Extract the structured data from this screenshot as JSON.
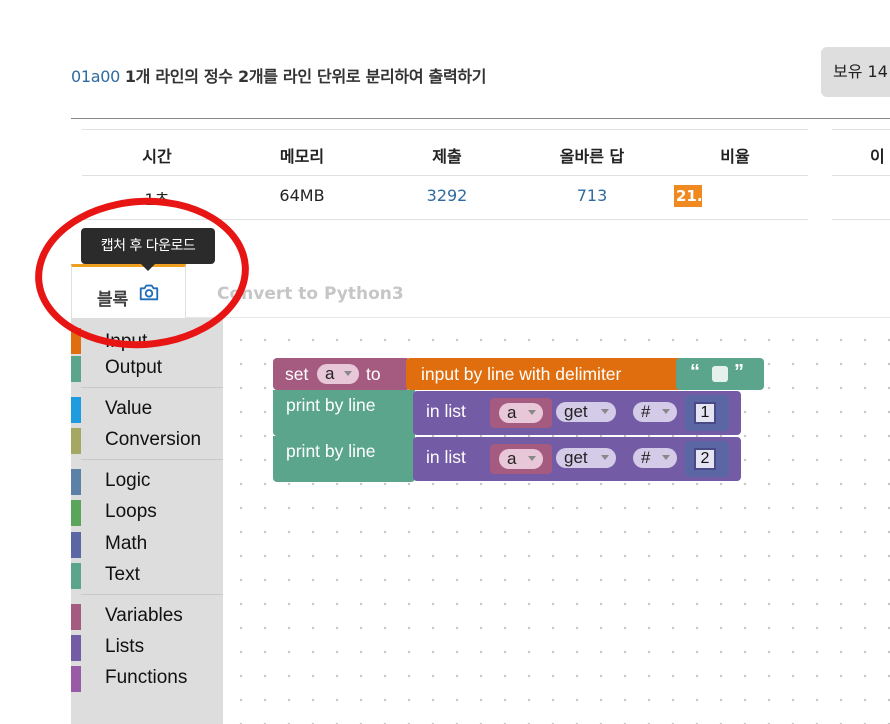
{
  "problem": {
    "id": "01a00",
    "title": "1개 라인의 정수 2개를 라인 단위로 분리하여 출력하기"
  },
  "owned_button": "보유 14",
  "stats": {
    "headers": [
      "시간",
      "메모리",
      "제출",
      "올바른 답",
      "비율"
    ],
    "time": "1초",
    "memory": "64MB",
    "submissions": "3292",
    "correct": "713",
    "ratio": "21.",
    "extra_header": "이"
  },
  "tooltip": "캡처 후 다운로드",
  "tabs": {
    "blocks": "블록",
    "convert": "Convert to Python3"
  },
  "toolbox": {
    "items": [
      {
        "label": "Input",
        "color": "#e06e0e"
      },
      {
        "label": "Output",
        "color": "#5aa58c"
      },
      {
        "label": "Value",
        "color": "#1f9be0"
      },
      {
        "label": "Conversion",
        "color": "#a4a863"
      },
      {
        "label": "Logic",
        "color": "#5c81a6"
      },
      {
        "label": "Loops",
        "color": "#5ba55b"
      },
      {
        "label": "Math",
        "color": "#5b67a5"
      },
      {
        "label": "Text",
        "color": "#5ba58c"
      },
      {
        "label": "Variables",
        "color": "#a55b80"
      },
      {
        "label": "Lists",
        "color": "#745ba5"
      },
      {
        "label": "Functions",
        "color": "#995ba5"
      }
    ]
  },
  "blocks": {
    "set": "set",
    "var": "a",
    "to": "to",
    "input": "input by line with delimiter",
    "quote_open": "“",
    "quote_close": "”",
    "print1": "print by line",
    "print2": "print by line",
    "inlist": "in list",
    "get": "get",
    "hash": "#",
    "idx1": "1",
    "idx2": "2"
  },
  "colors": {
    "variables": "#a55b80",
    "input": "#e06e0e",
    "output": "#5aa58c",
    "lists": "#745ba5",
    "text": "#5ba58c",
    "math": "#5b67a5",
    "link": "#2f6aa0",
    "badge": "#f0891f",
    "annotation": "#e81515"
  }
}
